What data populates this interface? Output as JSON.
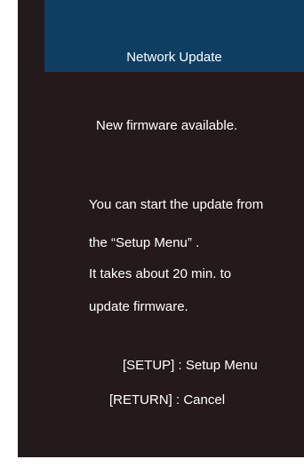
{
  "dialog": {
    "title": "Network Update",
    "headline": "New firmware available.",
    "body_lines": [
      "You can start the update from",
      "the “Setup Menu” .",
      "It takes about 20 min. to",
      "update firmware."
    ],
    "key_hints": [
      "[SETUP] : Setup Menu",
      "[RETURN] : Cancel"
    ]
  },
  "colors": {
    "background": "#241a19",
    "header": "#0f3e63",
    "text": "#ffffff"
  }
}
